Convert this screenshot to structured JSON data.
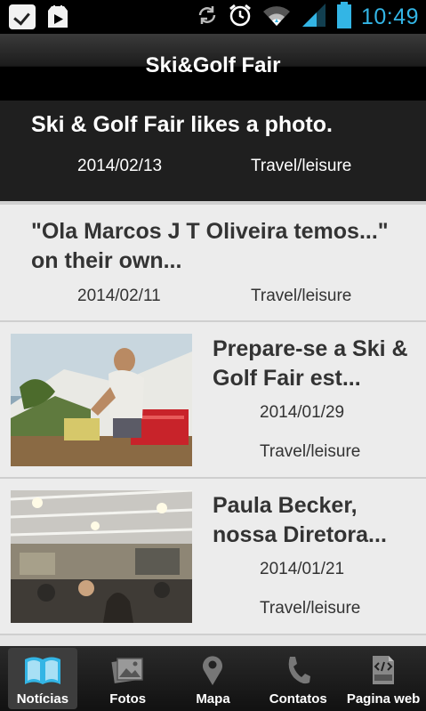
{
  "status_bar": {
    "time": "10:49",
    "icons": [
      "check-box-icon",
      "play-store-icon",
      "sync-icon",
      "alarm-icon",
      "wifi-icon",
      "signal-icon",
      "battery-icon"
    ]
  },
  "app": {
    "title": "Ski&Golf Fair"
  },
  "feed": [
    {
      "title": "Ski & Golf Fair likes a photo.",
      "date": "2014/02/13",
      "category": "Travel/leisure",
      "has_image": false,
      "selected": true
    },
    {
      "title_line1": "\"Ola Marcos J T Oliveira temos...\"",
      "title_line2": "on their own...",
      "date": "2014/02/11",
      "category": "Travel/leisure",
      "has_image": false
    },
    {
      "title_line1": "Prepare-se a Ski &",
      "title_line2": "Golf Fair est...",
      "date": "2014/01/29",
      "category": "Travel/leisure",
      "has_image": true
    },
    {
      "title_line1": "Paula Becker,",
      "title_line2": "nossa Diretora...",
      "date": "2014/01/21",
      "category": "Travel/leisure",
      "has_image": true
    }
  ],
  "bottom_nav": [
    {
      "label": "Notícias",
      "icon": "book-icon",
      "active": true
    },
    {
      "label": "Fotos",
      "icon": "photos-icon",
      "active": false
    },
    {
      "label": "Mapa",
      "icon": "map-pin-icon",
      "active": false
    },
    {
      "label": "Contatos",
      "icon": "phone-icon",
      "active": false
    },
    {
      "label": "Pagina web",
      "icon": "html-file-icon",
      "active": false
    }
  ],
  "colors": {
    "accent": "#33b5e5",
    "header": "#000000",
    "feed_bg": "#ececec",
    "selected_item": "#1f1f1f"
  }
}
